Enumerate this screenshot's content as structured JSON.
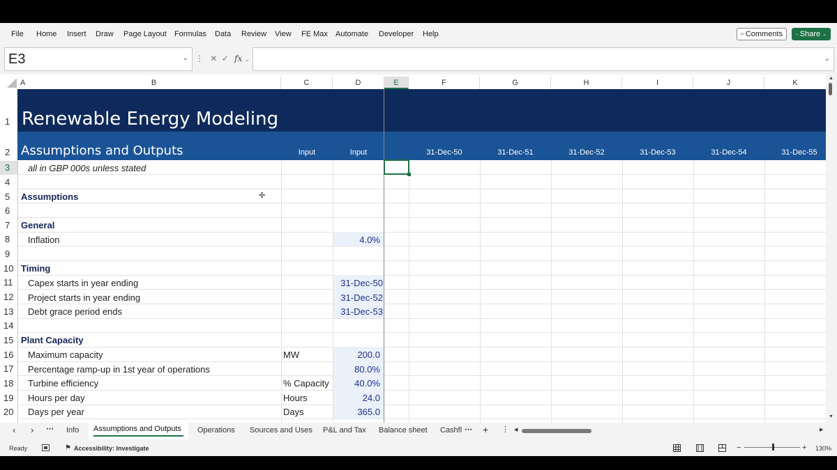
{
  "menu": [
    "File",
    "Home",
    "Insert",
    "Draw",
    "Page Layout",
    "Formulas",
    "Data",
    "Review",
    "View",
    "FE Max",
    "Automate",
    "Developer",
    "Help"
  ],
  "buttons": {
    "comments": "Comments",
    "share": "Share"
  },
  "formula_bar": {
    "name_box": "E3",
    "fx": "fx",
    "formula": ""
  },
  "columns": [
    "A",
    "B",
    "C",
    "D",
    "E",
    "F",
    "G",
    "H",
    "I",
    "J",
    "K"
  ],
  "selected_column": "E",
  "rows": [
    "1",
    "2",
    "3",
    "4",
    "5",
    "6",
    "7",
    "8",
    "9",
    "10",
    "11",
    "12",
    "13",
    "14",
    "15",
    "16",
    "17",
    "18",
    "19",
    "20"
  ],
  "selected_row": "3",
  "sheet": {
    "title": "Renewable Energy Modeling",
    "subtitle": "Assumptions and Outputs",
    "c2": "Input",
    "d2": "Input",
    "dates": [
      "31-Dec-50",
      "31-Dec-51",
      "31-Dec-52",
      "31-Dec-53",
      "31-Dec-54",
      "31-Dec-55"
    ],
    "note": "all in GBP 000s unless stated",
    "assumptions": "Assumptions",
    "general": "General",
    "inflation_label": "Inflation",
    "inflation_value": "4.0%",
    "timing": "Timing",
    "capex_label": "Capex starts in year ending",
    "capex_value": "31-Dec-50",
    "project_label": "Project starts in year ending",
    "project_value": "31-Dec-52",
    "debt_label": "Debt grace period ends",
    "debt_value": "31-Dec-53",
    "plant": "Plant Capacity",
    "max_label": "Maximum capacity",
    "max_unit": "MW",
    "max_value": "200.0",
    "ramp_label": "Percentage ramp-up in 1st year of operations",
    "ramp_value": "80.0%",
    "turbine_label": "Turbine efficiency",
    "turbine_unit": "% Capacity",
    "turbine_value": "40.0%",
    "hours_label": "Hours per day",
    "hours_unit": "Hours",
    "hours_value": "24.0",
    "days_label": "Days per year",
    "days_unit": "Days",
    "days_value": "365.0"
  },
  "tabs": [
    "Info",
    "Assumptions and Outputs",
    "Operations",
    "Sources and Uses",
    "P&L and Tax",
    "Balance sheet",
    "Cashfl"
  ],
  "active_tab": "Assumptions and Outputs",
  "status": {
    "ready": "Ready",
    "accessibility": "Accessibility: Investigate",
    "zoom": "130%"
  },
  "colors": {
    "title_bg": "#0e2a5c",
    "subtitle_bg": "#1a5496",
    "accent": "#1e7145",
    "input_fill": "#eaf1fb",
    "input_text": "#1f2f8c"
  }
}
